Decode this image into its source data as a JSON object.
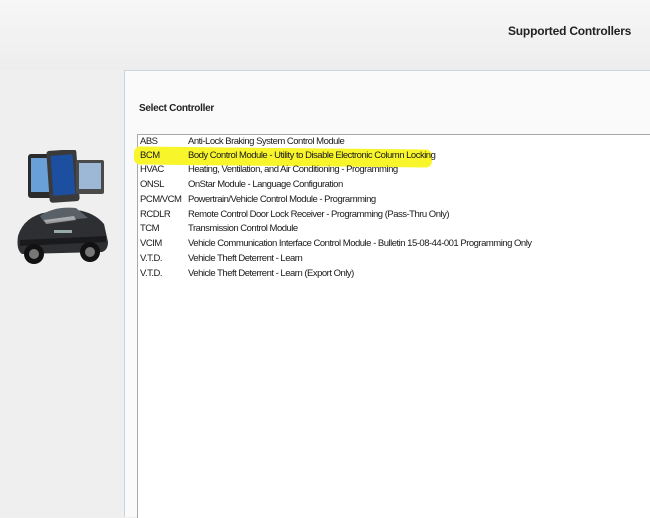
{
  "header": {
    "title": "Supported Controllers"
  },
  "panel": {
    "label": "Select Controller"
  },
  "controllers": [
    {
      "code": "ABS",
      "desc": "Anti-Lock Braking System Control Module"
    },
    {
      "code": "BCM",
      "desc": "Body Control Module - Utility to Disable Electronic Column Locking",
      "selected": true
    },
    {
      "code": "HVAC",
      "desc": "Heating, Ventilation, and Air Conditioning - Programming"
    },
    {
      "code": "ONSL",
      "desc": "OnStar Module - Language Configuration"
    },
    {
      "code": "PCM/VCM",
      "desc": "Powertrain/Vehicle Control Module - Programming"
    },
    {
      "code": "RCDLR",
      "desc": "Remote Control Door Lock Receiver - Programming (Pass-Thru Only)"
    },
    {
      "code": "TCM",
      "desc": "Transmission Control Module"
    },
    {
      "code": "VCIM",
      "desc": "Vehicle Communication Interface Control Module - Bulletin 15-08-44-001 Programming Only"
    },
    {
      "code": "V.T.D.",
      "desc": "Vehicle Theft Deterrent - Learn"
    },
    {
      "code": "V.T.D.",
      "desc": "Vehicle Theft Deterrent - Learn (Export Only)"
    }
  ],
  "colors": {
    "highlight": "#f8f52b",
    "panel_border": "#c6d5e0"
  },
  "icons": {
    "hero": "car-and-scan-tools-icon"
  }
}
